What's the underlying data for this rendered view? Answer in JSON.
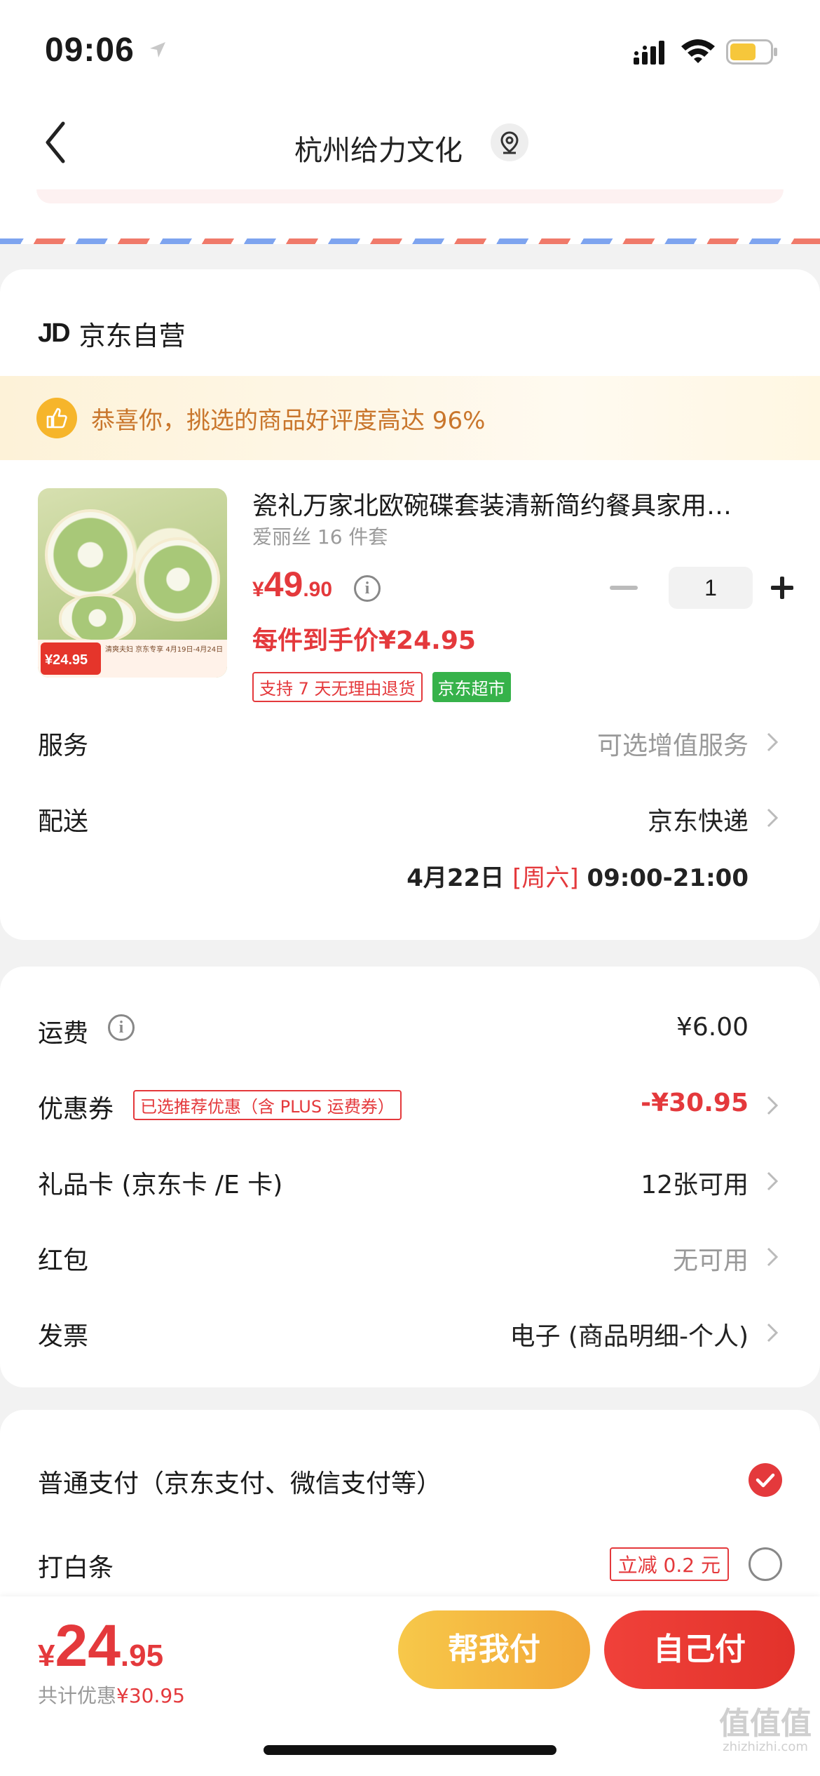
{
  "status": {
    "time": "09:06"
  },
  "nav": {
    "title": "杭州给力文化"
  },
  "shop": {
    "logo": "JD",
    "name": "京东自营"
  },
  "congrats": {
    "text": "恭喜你，挑选的商品好评度高达 96%"
  },
  "product": {
    "title": "瓷礼万家北欧碗碟套装清新简约餐具家用…",
    "spec": "爱丽丝 16 件套",
    "price_yen": "¥",
    "price_int": "49",
    "price_dec": ".90",
    "quantity": "1",
    "final_price": "每件到手价¥24.95",
    "img_price": "¥24.95",
    "img_promo": "清爽夫妇 京东专享 4月19日-4月24日",
    "badges": [
      "支持 7 天无理由退货",
      "京东超市"
    ]
  },
  "service": {
    "label": "服务",
    "value": "可选增值服务"
  },
  "delivery": {
    "label": "配送",
    "value": "京东快递",
    "date": "4月22日",
    "weekday": "[周六]",
    "time": "09:00-21:00"
  },
  "fees": {
    "freight": {
      "label": "运费",
      "value": "¥6.00"
    },
    "coupon": {
      "label": "优惠券",
      "badge": "已选推荐优惠（含 PLUS 运费券）",
      "value": "-¥30.95"
    },
    "giftcard": {
      "label": "礼品卡 (京东卡 /E 卡)",
      "value": "12张可用"
    },
    "redpacket": {
      "label": "红包",
      "value": "无可用"
    },
    "invoice": {
      "label": "发票",
      "value": "电子 (商品明细-个人)"
    }
  },
  "payment": {
    "normal": {
      "label": "普通支付（京东支付、微信支付等）",
      "selected": true
    },
    "baitiao": {
      "label": "打白条",
      "badge": "立减 0.2 元",
      "selected": false
    }
  },
  "bottom": {
    "total_yen": "¥",
    "total_int": "24",
    "total_dec": ".95",
    "saved_label": "共计优惠",
    "saved_value": "¥30.95",
    "help_pay": "帮我付",
    "self_pay": "自己付"
  },
  "watermark": {
    "title": "值值值",
    "sub": "zhizhizhi.com"
  },
  "colors": {
    "accent": "#e4393c",
    "gold": "#f2a838",
    "success": "#36b24a"
  }
}
